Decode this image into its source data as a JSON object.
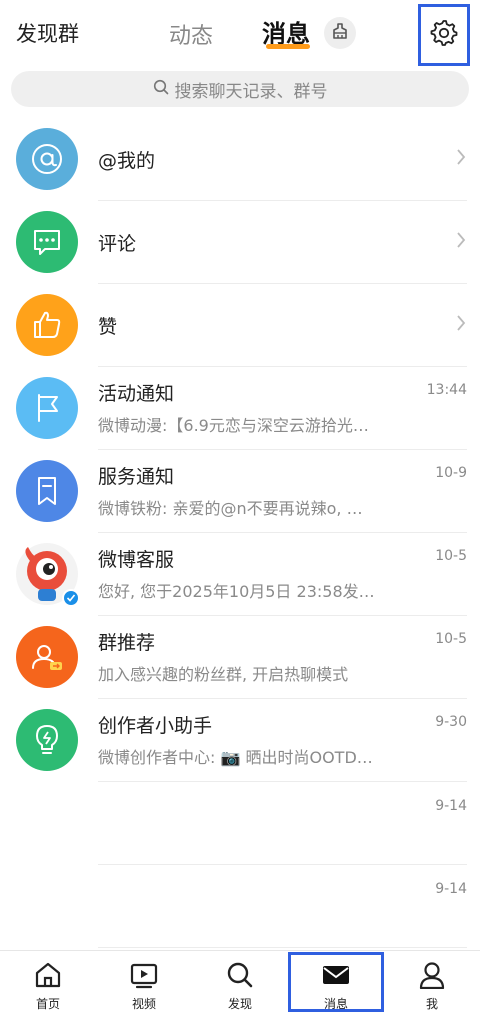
{
  "header": {
    "left_label": "发现群",
    "tab_dynamic": "动态",
    "tab_messages": "消息",
    "accent_color": "#ff9b1a",
    "clean_icon": "broom-icon",
    "settings_icon": "gear-icon"
  },
  "search": {
    "placeholder": "搜索聊天记录、群号",
    "icon": "search-icon"
  },
  "messages": [
    {
      "title": "@我的",
      "subtitle": "",
      "time": "",
      "icon": "at-icon",
      "color": "#5aaedb"
    },
    {
      "title": "评论",
      "subtitle": "",
      "time": "",
      "icon": "comment-icon",
      "color": "#2dbb73"
    },
    {
      "title": "赞",
      "subtitle": "",
      "time": "",
      "icon": "thumbs-up-icon",
      "color": "#ffa21a"
    },
    {
      "title": "活动通知",
      "subtitle": "微博动漫:【6.9元恋与深空云游拾光…",
      "time": "13:44",
      "icon": "flag-icon",
      "color": "#5bbcf4"
    },
    {
      "title": "服务通知",
      "subtitle": "微博铁粉: 亲爱的@n不要再说辣o, …",
      "time": "10-9",
      "icon": "bookmark-icon",
      "color": "#4e87e6"
    },
    {
      "title": "微博客服",
      "subtitle": "您好, 您于2025年10月5日 23:58发…",
      "time": "10-5",
      "icon": "weibo-mascot-avatar",
      "color": "#e94d3b"
    },
    {
      "title": "群推荐",
      "subtitle": "加入感兴趣的粉丝群, 开启热聊模式",
      "time": "10-5",
      "icon": "group-icon",
      "color": "#f5651c"
    },
    {
      "title": "创作者小助手",
      "subtitle": "微博创作者中心: 📷 晒出时尚OOTD…",
      "time": "9-30",
      "icon": "lightbulb-icon",
      "color": "#2dbb73"
    },
    {
      "title": "",
      "subtitle": "",
      "time": "9-14",
      "icon": "",
      "color": ""
    },
    {
      "title": "",
      "subtitle": "",
      "time": "9-14",
      "icon": "",
      "color": ""
    }
  ],
  "nav": [
    {
      "label": "首页",
      "icon": "home-icon"
    },
    {
      "label": "视频",
      "icon": "video-icon"
    },
    {
      "label": "发现",
      "icon": "discover-search-icon"
    },
    {
      "label": "消息",
      "icon": "mail-icon"
    },
    {
      "label": "我",
      "icon": "profile-icon"
    }
  ]
}
